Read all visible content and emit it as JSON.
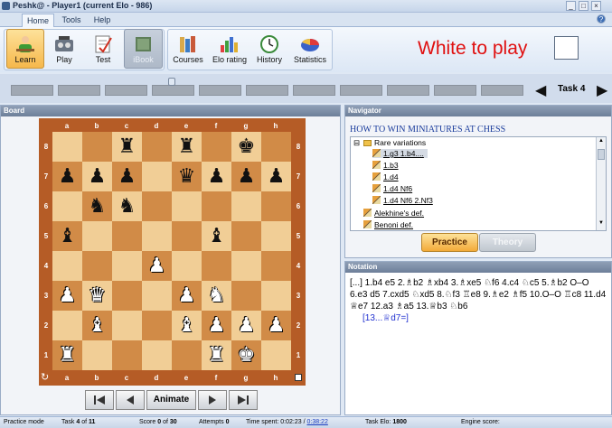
{
  "window": {
    "title": "Peshk@ - Player1 (current Elo - 986)"
  },
  "tabs": [
    "Home",
    "Tools",
    "Help"
  ],
  "ribbon": {
    "buttons": [
      {
        "label": "Learn",
        "icon": "learn-icon",
        "state": "active"
      },
      {
        "label": "Play",
        "icon": "play-icon",
        "state": "normal"
      },
      {
        "label": "Test",
        "icon": "test-icon",
        "state": "normal"
      },
      {
        "label": "iBook",
        "icon": "ibook-icon",
        "state": "disabled"
      },
      {
        "label": "Courses",
        "icon": "courses-icon",
        "state": "normal"
      },
      {
        "label": "Elo rating",
        "icon": "elo-rating-icon",
        "state": "normal"
      },
      {
        "label": "History",
        "icon": "history-icon",
        "state": "normal"
      },
      {
        "label": "Statistics",
        "icon": "statistics-icon",
        "state": "normal"
      }
    ],
    "turn_text": "White to play"
  },
  "progress": {
    "task_label": "Task 4",
    "segments": 11,
    "current_segment": 4
  },
  "board": {
    "panel_title": "Board",
    "files": [
      "a",
      "b",
      "c",
      "d",
      "e",
      "f",
      "g",
      "h"
    ],
    "ranks": [
      "8",
      "7",
      "6",
      "5",
      "4",
      "3",
      "2",
      "1"
    ],
    "pieces": {
      "c8": "bR",
      "e8": "bR",
      "g8": "bK",
      "a7": "bP",
      "b7": "bP",
      "c7": "bP",
      "e7": "bQ",
      "f7": "bP",
      "g7": "bP",
      "h7": "bP",
      "b6": "bN",
      "c6": "bN",
      "a5": "bB",
      "f5": "bB",
      "d4": "wP",
      "a3": "wP",
      "b3": "wQ",
      "e3": "wP",
      "f3": "wN",
      "b2": "wB",
      "e2": "wB",
      "f2": "wP",
      "g2": "wP",
      "h2": "wP",
      "a1": "wR",
      "f1": "wR",
      "g1": "wK"
    },
    "controls": {
      "first": "first-move",
      "prev": "previous-move",
      "animate": "Animate",
      "next": "next-move",
      "last": "last-move"
    }
  },
  "navigator": {
    "panel_title": "Navigator",
    "book_title": "HOW TO WIN MINIATURES AT CHESS",
    "tree": [
      {
        "label": "Rare variations",
        "type": "folder",
        "level": 0
      },
      {
        "label": "1.g3 1.b4....",
        "type": "item",
        "level": 1,
        "selected": true
      },
      {
        "label": "1.b3",
        "type": "item",
        "level": 1
      },
      {
        "label": "1.d4",
        "type": "item",
        "level": 1
      },
      {
        "label": "1.d4 Nf6",
        "type": "item",
        "level": 1
      },
      {
        "label": "1.d4 Nf6 2.Nf3",
        "type": "item",
        "level": 1
      },
      {
        "label": "Alekhine's def.",
        "type": "item",
        "level": 0
      },
      {
        "label": "Benoni def.",
        "type": "item",
        "level": 0
      }
    ],
    "practice_label": "Practice",
    "theory_label": "Theory"
  },
  "notation": {
    "panel_title": "Notation",
    "moves": "[...] 1.b4 e5 2.♗b2 ♗xb4 3.♗xe5 ♘f6 4.c4 ♘c5 5.♗b2 O–O 6.e3 d5 7.cxd5 ♘xd5 8.♘f3 ♖e8 9.♗e2 ♗f5 10.O–O ♖c8 11.d4 ♕e7 12.a3 ♗a5 13.♕b3 ♘b6",
    "variation": "[13...♕d7=]"
  },
  "status": {
    "mode": "Practice mode",
    "task_prefix": "Task",
    "task": "4",
    "task_of": "of",
    "task_total": "11",
    "score_prefix": "Score",
    "score": "0",
    "score_of": "of",
    "score_total": "30",
    "attempts_label": "Attempts",
    "attempts": "0",
    "time_label": "Time spent:",
    "time_spent": "0:02:23",
    "time_sep": "/",
    "time_total": "0:38:22",
    "elo_label": "Task Elo:",
    "elo": "1800",
    "engine_label": "Engine score:"
  }
}
